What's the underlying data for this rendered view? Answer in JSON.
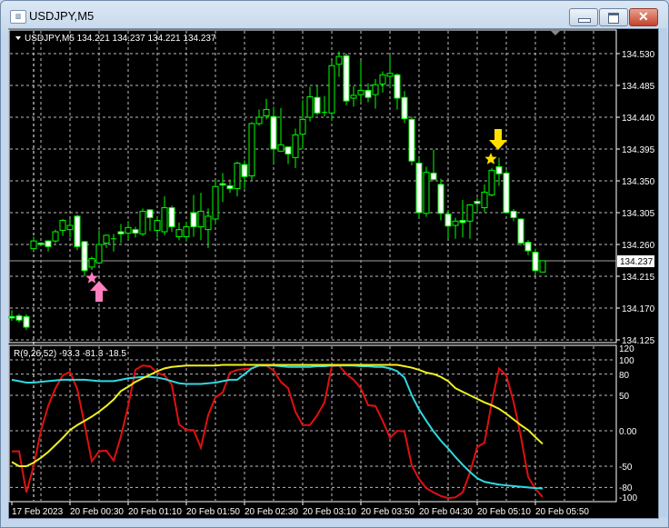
{
  "window": {
    "title": "USDJPY,M5",
    "icon": "chart-window-icon",
    "buttons": [
      "minimize",
      "maximize",
      "close"
    ]
  },
  "chart": {
    "header": "USDJPY,M5  134.221 134.237 134.221 134.237",
    "current_price": "134.237",
    "price_ticks": [
      "134.530",
      "134.485",
      "134.440",
      "134.395",
      "134.350",
      "134.305",
      "134.260",
      "134.215",
      "134.170",
      "134.125"
    ],
    "time_ticks": [
      "17 Feb 2023",
      "20 Feb 00:30",
      "20 Feb 01:10",
      "20 Feb 01:50",
      "20 Feb 02:30",
      "20 Feb 03:10",
      "20 Feb 03:50",
      "20 Feb 04:30",
      "20 Feb 05:10",
      "20 Feb 05:50"
    ],
    "colors": {
      "candle": "#00ff00",
      "bear_fill": "#ffffff",
      "bull_fill": "#000000",
      "grid": "#c0c0c0",
      "buy_arrow": "#ff7fbf",
      "sell_arrow": "#ffe000"
    },
    "signals": [
      {
        "type": "buy",
        "icon": "pink-up-arrow-icon",
        "star": "pink-star-icon",
        "candle_index": 11
      },
      {
        "type": "sell",
        "icon": "yellow-down-arrow-icon",
        "star": "yellow-star-icon",
        "candle_index": 66
      }
    ]
  },
  "indicator": {
    "label": "R(9,26,52) -93.3 -81.3 -18.5",
    "ticks": [
      "120",
      "100",
      "80",
      "50",
      "0.00",
      "-50",
      "-80",
      "-100"
    ]
  },
  "chart_data": {
    "type": "candlestick",
    "symbol": "USDJPY",
    "timeframe": "M5",
    "ylim": [
      134.125,
      134.53
    ],
    "ohlc": [
      [
        134.158,
        134.167,
        134.152,
        134.156
      ],
      [
        134.159,
        134.162,
        134.15,
        134.153
      ],
      [
        134.158,
        134.161,
        134.139,
        134.143
      ],
      [
        134.254,
        134.271,
        134.251,
        134.265
      ],
      [
        134.262,
        134.263,
        134.259,
        134.26
      ],
      [
        134.265,
        134.266,
        134.25,
        134.257
      ],
      [
        134.265,
        134.281,
        134.262,
        134.278
      ],
      [
        134.28,
        134.296,
        134.272,
        134.294
      ],
      [
        134.281,
        134.296,
        134.27,
        134.287
      ],
      [
        134.3,
        134.302,
        134.252,
        134.257
      ],
      [
        134.264,
        134.265,
        134.215,
        134.223
      ],
      [
        134.228,
        134.243,
        134.224,
        134.24
      ],
      [
        134.234,
        134.28,
        134.232,
        134.26
      ],
      [
        134.262,
        134.274,
        134.255,
        134.273
      ],
      [
        134.268,
        134.275,
        134.25,
        134.268
      ],
      [
        134.278,
        134.289,
        134.262,
        134.275
      ],
      [
        134.276,
        134.293,
        134.267,
        134.284
      ],
      [
        134.281,
        134.285,
        134.27,
        134.276
      ],
      [
        134.275,
        134.311,
        134.272,
        134.307
      ],
      [
        134.309,
        134.31,
        134.279,
        134.298
      ],
      [
        134.28,
        134.299,
        134.27,
        134.294
      ],
      [
        134.278,
        134.328,
        134.273,
        134.312
      ],
      [
        134.312,
        134.315,
        134.278,
        134.285
      ],
      [
        134.271,
        134.291,
        134.266,
        134.281
      ],
      [
        134.271,
        134.292,
        134.264,
        134.285
      ],
      [
        134.305,
        134.33,
        134.271,
        134.285
      ],
      [
        134.285,
        134.333,
        134.266,
        134.307
      ],
      [
        134.281,
        134.311,
        134.255,
        134.3
      ],
      [
        134.296,
        134.352,
        134.288,
        134.342
      ],
      [
        134.346,
        134.361,
        134.32,
        134.344
      ],
      [
        134.343,
        134.352,
        134.333,
        134.339
      ],
      [
        134.339,
        134.377,
        134.328,
        134.375
      ],
      [
        134.373,
        134.379,
        134.339,
        134.356
      ],
      [
        134.357,
        134.433,
        134.351,
        134.431
      ],
      [
        134.431,
        134.451,
        134.428,
        134.44
      ],
      [
        134.442,
        134.466,
        134.437,
        134.451
      ],
      [
        134.441,
        134.455,
        134.375,
        134.395
      ],
      [
        134.392,
        134.453,
        134.392,
        134.401
      ],
      [
        134.398,
        134.398,
        134.374,
        134.388
      ],
      [
        134.383,
        134.424,
        134.368,
        134.415
      ],
      [
        134.416,
        134.464,
        134.395,
        134.437
      ],
      [
        134.44,
        134.483,
        134.434,
        134.469
      ],
      [
        134.468,
        134.484,
        134.443,
        134.446
      ],
      [
        134.447,
        134.47,
        134.441,
        134.447
      ],
      [
        134.446,
        134.52,
        134.435,
        134.513
      ],
      [
        134.515,
        134.533,
        134.497,
        134.526
      ],
      [
        134.527,
        134.53,
        134.457,
        134.463
      ],
      [
        134.467,
        134.484,
        134.455,
        134.471
      ],
      [
        134.472,
        134.52,
        134.461,
        134.478
      ],
      [
        134.478,
        134.488,
        134.461,
        134.468
      ],
      [
        134.472,
        134.494,
        134.452,
        134.486
      ],
      [
        134.487,
        134.505,
        134.475,
        134.5
      ],
      [
        134.498,
        134.528,
        134.481,
        134.502
      ],
      [
        134.5,
        134.502,
        134.451,
        134.467
      ],
      [
        134.468,
        134.477,
        134.432,
        134.438
      ],
      [
        134.437,
        134.441,
        134.372,
        134.378
      ],
      [
        134.375,
        134.383,
        134.297,
        134.305
      ],
      [
        134.304,
        134.37,
        134.299,
        134.362
      ],
      [
        134.361,
        134.394,
        134.35,
        134.352
      ],
      [
        134.345,
        134.353,
        134.294,
        134.304
      ],
      [
        134.303,
        134.309,
        134.268,
        134.286
      ],
      [
        134.287,
        134.298,
        134.268,
        134.293
      ],
      [
        134.294,
        134.323,
        134.27,
        134.291
      ],
      [
        134.293,
        134.317,
        134.268,
        134.316
      ],
      [
        134.321,
        134.326,
        134.305,
        134.318
      ],
      [
        134.312,
        134.345,
        134.306,
        134.334
      ],
      [
        134.33,
        134.368,
        134.328,
        134.365
      ],
      [
        134.37,
        134.383,
        134.343,
        134.36
      ],
      [
        134.361,
        134.365,
        134.305,
        134.305
      ],
      [
        134.307,
        134.31,
        134.293,
        134.298
      ],
      [
        134.296,
        134.297,
        134.258,
        134.262
      ],
      [
        134.263,
        134.266,
        134.245,
        134.251
      ],
      [
        134.249,
        134.254,
        134.216,
        134.223
      ],
      [
        134.221,
        134.237,
        134.221,
        134.237
      ]
    ],
    "indicator": {
      "ylim": [
        -100,
        120
      ],
      "series": [
        {
          "name": "fast",
          "color": "#e01010",
          "values": [
            -29,
            -29,
            -87,
            -50,
            0,
            35,
            60,
            78,
            83,
            59,
            9,
            -43,
            -29,
            -28,
            -42,
            -8,
            35,
            86,
            92,
            91,
            82,
            78,
            65,
            9,
            1,
            1,
            -24,
            22,
            47,
            54,
            82,
            86,
            87,
            88,
            92,
            92,
            85,
            69,
            60,
            27,
            8,
            8,
            22,
            40,
            91,
            92,
            80,
            72,
            60,
            36,
            35,
            14,
            -10,
            0,
            -1,
            -49,
            -68,
            -81,
            -87,
            -92,
            -95,
            -94,
            -87,
            -59,
            -23,
            -17,
            40,
            88,
            78,
            41,
            -8,
            -65,
            -82,
            -93.3
          ]
        },
        {
          "name": "mid",
          "color": "#30d8e0",
          "values": [
            72,
            70,
            68,
            68,
            69,
            70,
            71,
            72,
            72,
            72,
            72,
            71,
            70,
            70,
            70,
            72,
            74,
            75,
            76,
            76,
            75,
            73,
            70,
            67,
            66,
            66,
            66,
            67,
            68,
            70,
            72,
            72,
            80,
            88,
            92,
            92,
            92,
            91,
            90,
            90,
            90,
            90,
            91,
            91,
            92,
            92,
            92,
            92,
            91,
            91,
            90,
            90,
            88,
            84,
            75,
            50,
            30,
            14,
            -1,
            -14,
            -25,
            -37,
            -48,
            -58,
            -67,
            -72,
            -74,
            -76,
            -77,
            -78,
            -79,
            -80,
            -81,
            -81.3
          ]
        },
        {
          "name": "slow",
          "color": "#f0f020",
          "values": [
            -44,
            -50,
            -50,
            -45,
            -38,
            -30,
            -20,
            -10,
            1,
            8,
            14,
            20,
            27,
            35,
            44,
            56,
            62,
            69,
            74,
            79,
            84,
            88,
            90,
            91,
            92,
            92,
            92,
            92,
            92,
            93,
            93,
            93,
            93,
            93,
            93,
            93,
            93,
            93,
            93,
            93,
            93,
            93,
            93,
            93,
            93,
            93,
            93,
            93,
            93,
            93,
            93,
            93,
            93,
            93,
            91,
            89,
            86,
            82,
            80,
            76,
            70,
            60,
            55,
            50,
            45,
            40,
            36,
            31,
            24,
            16,
            8,
            1,
            -9,
            -18.5
          ]
        }
      ]
    }
  }
}
